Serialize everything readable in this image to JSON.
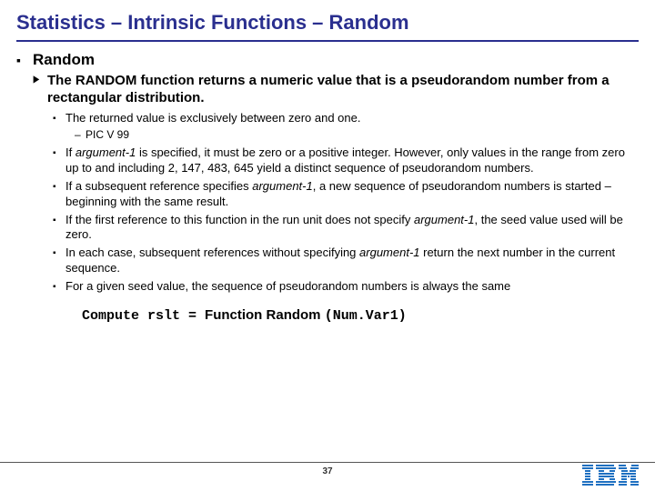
{
  "title": "Statistics – Intrinsic Functions – Random",
  "section": "Random",
  "intro": "The RANDOM function returns a numeric value that is a pseudorandom number from a rectangular distribution.",
  "bullets": {
    "b1": "The returned value is exclusively between zero and one.",
    "b1a": "PIC V 99",
    "b2_pre": "If ",
    "b2_arg": "argument-1",
    "b2_post": " is specified, it must be zero or a positive integer. However, only values in the range from zero up to and including 2, 147, 483, 645 yield a distinct sequence of pseudorandom numbers.",
    "b3_pre": "If a subsequent reference specifies ",
    "b3_arg": "argument-1",
    "b3_post": ", a new sequence of pseudorandom numbers is started – beginning with the same result.",
    "b4_pre": "If the first reference to this function in the run unit does not specify ",
    "b4_arg": "argument-1",
    "b4_post": ", the seed value used will be zero.",
    "b5_pre": "In each case, subsequent references without specifying ",
    "b5_arg": "argument-1",
    "b5_post": " return the next number in the current sequence.",
    "b6": "For a given seed value, the sequence of pseudorandom numbers is always the same"
  },
  "code": {
    "lhs": "Compute rslt = ",
    "fn": "Function Random ",
    "args": "(Num.Var1)"
  },
  "pagenum": "37",
  "logo_alt": "IBM"
}
